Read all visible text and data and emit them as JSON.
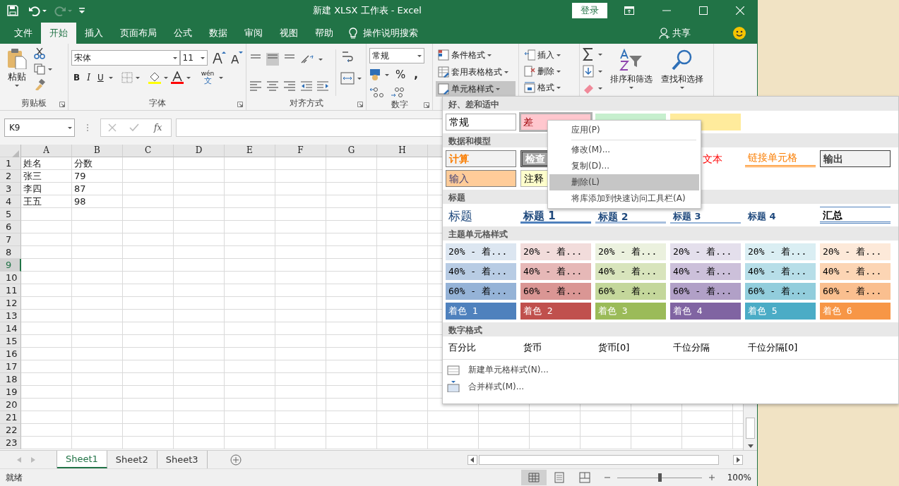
{
  "title_bar": {
    "title": "新建 XLSX 工作表 - Excel",
    "login": "登录"
  },
  "tabs": [
    {
      "label": "文件",
      "selected": false
    },
    {
      "label": "开始",
      "selected": true
    },
    {
      "label": "插入",
      "selected": false
    },
    {
      "label": "页面布局",
      "selected": false
    },
    {
      "label": "公式",
      "selected": false
    },
    {
      "label": "数据",
      "selected": false
    },
    {
      "label": "审阅",
      "selected": false
    },
    {
      "label": "视图",
      "selected": false
    },
    {
      "label": "帮助",
      "selected": false
    }
  ],
  "tell_me": "操作说明搜索",
  "share": "共享",
  "ribbon": {
    "clipboard": {
      "paste": "粘贴",
      "label": "剪贴板"
    },
    "font": {
      "name": "宋体",
      "size": "11",
      "bold": "B",
      "italic": "I",
      "underline": "U",
      "phonetic_top": "wén",
      "phonetic_bottom": "文",
      "label": "字体"
    },
    "alignment": {
      "label": "对齐方式"
    },
    "number": {
      "format": "常规",
      "percent": "%",
      "comma": ",",
      "label": "数字"
    },
    "styles": [
      {
        "label": "条件格式",
        "selected": false
      },
      {
        "label": "套用表格格式",
        "selected": false
      },
      {
        "label": "单元格样式",
        "selected": true
      }
    ],
    "cells": [
      "插入",
      "删除",
      "格式"
    ],
    "editing": {
      "sort": "排序和筛选",
      "find": "查找和选择"
    }
  },
  "formula_bar": {
    "name_box": "K9",
    "fx": "fx"
  },
  "sheet": {
    "columns": [
      "A",
      "B",
      "C",
      "D",
      "E",
      "F",
      "G",
      "H"
    ],
    "row_headers": [
      {
        "label": "1",
        "selected": false
      },
      {
        "label": "2",
        "selected": false
      },
      {
        "label": "3",
        "selected": false
      },
      {
        "label": "4",
        "selected": false
      },
      {
        "label": "5",
        "selected": false
      },
      {
        "label": "6",
        "selected": false
      },
      {
        "label": "7",
        "selected": false
      },
      {
        "label": "8",
        "selected": false
      },
      {
        "label": "9",
        "selected": true
      },
      {
        "label": "10",
        "selected": false
      },
      {
        "label": "11",
        "selected": false
      },
      {
        "label": "12",
        "selected": false
      },
      {
        "label": "13",
        "selected": false
      },
      {
        "label": "14",
        "selected": false
      },
      {
        "label": "15",
        "selected": false
      },
      {
        "label": "16",
        "selected": false
      },
      {
        "label": "17",
        "selected": false
      },
      {
        "label": "18",
        "selected": false
      },
      {
        "label": "19",
        "selected": false
      },
      {
        "label": "20",
        "selected": false
      },
      {
        "label": "21",
        "selected": false
      },
      {
        "label": "22",
        "selected": false
      },
      {
        "label": "23",
        "selected": false
      }
    ],
    "rows": [
      [
        "姓名",
        "分数"
      ],
      [
        "张三",
        "79"
      ],
      [
        "李四",
        "87"
      ],
      [
        "王五",
        "98"
      ]
    ]
  },
  "sheet_tabs": [
    {
      "label": "Sheet1",
      "selected": true
    },
    {
      "label": "Sheet2",
      "selected": false
    },
    {
      "label": "Sheet3",
      "selected": false
    }
  ],
  "status_bar": {
    "text": "就绪",
    "zoom": "100%",
    "level": 0.5
  },
  "cell_styles": {
    "sections": [
      {
        "title": "好、差和适中",
        "items": [
          {
            "label": "常规",
            "kind": "normal",
            "selected": false
          },
          {
            "label": "差",
            "kind": "bad",
            "selected": true
          },
          {
            "kind": "good",
            "selected": false
          },
          {
            "kind": "neutral",
            "selected": false
          }
        ]
      },
      {
        "title": "数据和模型",
        "items": [
          {
            "label": "计算",
            "kind": "calc",
            "selected": false
          },
          {
            "label": "检查",
            "kind": "check",
            "selected": false
          },
          {
            "kind": "explanatory"
          },
          {
            "label": "文本",
            "kind": "warning",
            "selected": false
          },
          {
            "label": "链接单元格",
            "kind": "link",
            "selected": false
          },
          {
            "label": "输出",
            "kind": "output",
            "selected": false
          },
          {
            "label": "输入",
            "kind": "input",
            "selected": false
          },
          {
            "label": "注释",
            "kind": "note",
            "selected": false
          }
        ]
      },
      {
        "title": "标题",
        "items": [
          {
            "label": "标题",
            "kind": "title",
            "selected": false
          },
          {
            "label": "标题 1",
            "kind": "h1",
            "selected": false
          },
          {
            "label": "标题 2",
            "kind": "h2",
            "selected": false
          },
          {
            "label": "标题 3",
            "kind": "h3",
            "selected": false
          },
          {
            "label": "标题 4",
            "kind": "h4",
            "selected": false
          },
          {
            "label": "汇总",
            "kind": "total",
            "selected": false
          }
        ]
      },
      {
        "title": "主题单元格样式",
        "items": [
          {
            "label": "20% - 着...",
            "kind": "tint",
            "color": "#dce6f1",
            "selected": false
          },
          {
            "label": "20% - 着...",
            "kind": "tint",
            "color": "#f2dcdb",
            "selected": false
          },
          {
            "label": "20% - 着...",
            "kind": "tint",
            "color": "#ebf1de",
            "selected": false
          },
          {
            "label": "20% - 着...",
            "kind": "tint",
            "color": "#e4dfec",
            "selected": false
          },
          {
            "label": "20% - 着...",
            "kind": "tint",
            "color": "#daeef3",
            "selected": false
          },
          {
            "label": "20% - 着...",
            "kind": "tint",
            "color": "#fde9d9",
            "selected": false
          },
          {
            "label": "40% - 着...",
            "kind": "tint",
            "color": "#b8cce4",
            "selected": false
          },
          {
            "label": "40% - 着...",
            "kind": "tint",
            "color": "#e6b8b7",
            "selected": false
          },
          {
            "label": "40% - 着...",
            "kind": "tint",
            "color": "#d8e4bc",
            "selected": false
          },
          {
            "label": "40% - 着...",
            "kind": "tint",
            "color": "#ccc0da",
            "selected": false
          },
          {
            "label": "40% - 着...",
            "kind": "tint",
            "color": "#b7dee8",
            "selected": false
          },
          {
            "label": "40% - 着...",
            "kind": "tint",
            "color": "#fcd5b4",
            "selected": false
          },
          {
            "label": "60% - 着...",
            "kind": "tint",
            "color": "#95b3d7",
            "selected": false
          },
          {
            "label": "60% - 着...",
            "kind": "tint",
            "color": "#da9694",
            "selected": false
          },
          {
            "label": "60% - 着...",
            "kind": "tint",
            "color": "#c4d79b",
            "selected": false
          },
          {
            "label": "60% - 着...",
            "kind": "tint",
            "color": "#b1a0c7",
            "selected": false
          },
          {
            "label": "60% - 着...",
            "kind": "tint",
            "color": "#92cddc",
            "selected": false
          },
          {
            "label": "60% - 着...",
            "kind": "tint",
            "color": "#fabf8f",
            "selected": false
          },
          {
            "label": "着色 1",
            "kind": "accent",
            "color": "#4f81bd",
            "selected": false
          },
          {
            "label": "着色 2",
            "kind": "accent",
            "color": "#c0504d",
            "selected": false
          },
          {
            "label": "着色 3",
            "kind": "accent",
            "color": "#9bbb59",
            "selected": false
          },
          {
            "label": "着色 4",
            "kind": "accent",
            "color": "#8064a2",
            "selected": false
          },
          {
            "label": "着色 5",
            "kind": "accent",
            "color": "#4bacc6",
            "selected": false
          },
          {
            "label": "着色 6",
            "kind": "accent",
            "color": "#f79646",
            "selected": false
          }
        ]
      },
      {
        "title": "数字格式",
        "items": [
          {
            "label": "百分比",
            "kind": "number",
            "selected": false
          },
          {
            "label": "货币",
            "kind": "number",
            "selected": false
          },
          {
            "label": "货币[0]",
            "kind": "number",
            "selected": false
          },
          {
            "label": "千位分隔",
            "kind": "number",
            "selected": false
          },
          {
            "label": "千位分隔[0]",
            "kind": "number",
            "selected": false
          }
        ]
      }
    ],
    "footer": [
      {
        "label": "新建单元格样式(N)...",
        "kind": "new"
      },
      {
        "label": "合并样式(M)...",
        "kind": "merge"
      }
    ]
  },
  "context_menu": [
    {
      "label": "应用(P)",
      "selected": false,
      "separator_after": true
    },
    {
      "label": "修改(M)...",
      "selected": false,
      "separator_after": false
    },
    {
      "label": "复制(D)...",
      "selected": false,
      "separator_after": false
    },
    {
      "label": "删除(L)",
      "selected": true,
      "separator_after": false
    },
    {
      "label": "将库添加到快速访问工具栏(A)",
      "selected": false,
      "separator_after": false
    }
  ]
}
